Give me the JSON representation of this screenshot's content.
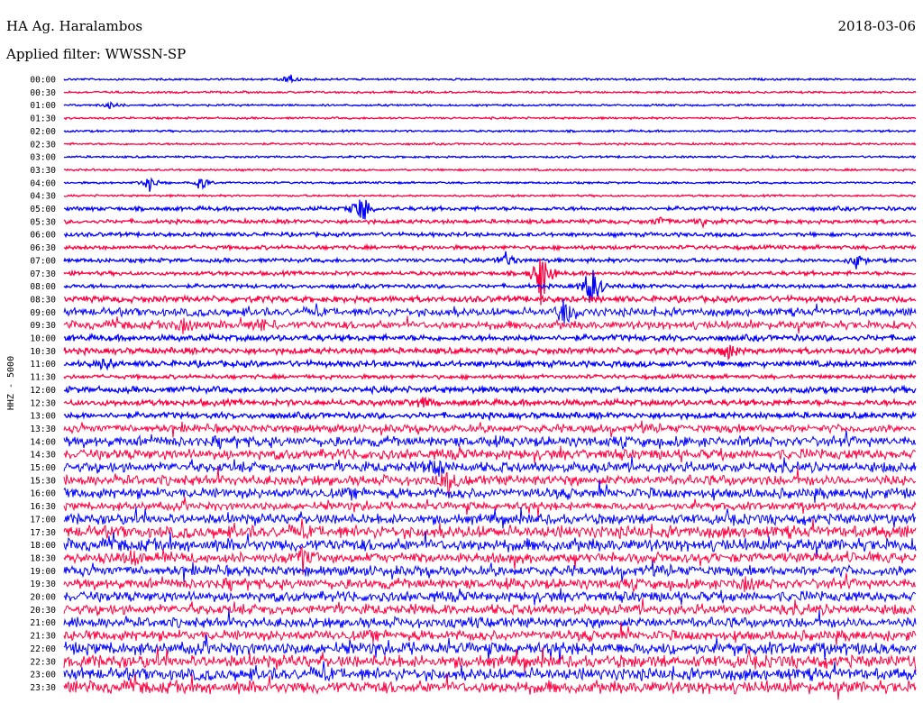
{
  "header": {
    "station": "HA Ag. Haralambos",
    "date": "2018-03-06",
    "filter": "Applied filter: WWSSN-SP"
  },
  "chart_data": {
    "type": "line",
    "ylabel": "HHZ - 5000",
    "row_labels": [
      "00:00",
      "00:30",
      "01:00",
      "01:30",
      "02:00",
      "02:30",
      "03:00",
      "03:30",
      "04:00",
      "04:30",
      "05:00",
      "05:30",
      "06:00",
      "06:30",
      "07:00",
      "07:30",
      "08:00",
      "08:30",
      "09:00",
      "09:30",
      "10:00",
      "10:30",
      "11:00",
      "11:30",
      "12:00",
      "12:30",
      "13:00",
      "13:30",
      "14:00",
      "14:30",
      "15:00",
      "15:30",
      "16:00",
      "16:30",
      "17:00",
      "17:30",
      "18:00",
      "18:30",
      "19:00",
      "19:30",
      "20:00",
      "20:30",
      "21:00",
      "21:30",
      "22:00",
      "22:30",
      "23:00",
      "23:30"
    ],
    "row_colors": [
      "#0000ff",
      "#ff0040"
    ],
    "noise_level": [
      1,
      1,
      1,
      1,
      1,
      1,
      1,
      1,
      1,
      1,
      2,
      2,
      2,
      2,
      2,
      2,
      2,
      3,
      4,
      4,
      3,
      3,
      3,
      2,
      3,
      3,
      3,
      4,
      5,
      5,
      5,
      5,
      5,
      4,
      5,
      6,
      6,
      5,
      5,
      5,
      5,
      5,
      5,
      5,
      6,
      6,
      6,
      6
    ],
    "events": [
      {
        "row": 0,
        "x": 0.265,
        "amp": 8
      },
      {
        "row": 2,
        "x": 0.055,
        "amp": 5
      },
      {
        "row": 8,
        "x": 0.1,
        "amp": 10
      },
      {
        "row": 8,
        "x": 0.16,
        "amp": 10
      },
      {
        "row": 10,
        "x": 0.35,
        "amp": 24
      },
      {
        "row": 11,
        "x": 0.7,
        "amp": 7
      },
      {
        "row": 11,
        "x": 0.75,
        "amp": 6
      },
      {
        "row": 14,
        "x": 0.52,
        "amp": 12
      },
      {
        "row": 14,
        "x": 0.93,
        "amp": 10
      },
      {
        "row": 15,
        "x": 0.56,
        "amp": 50
      },
      {
        "row": 16,
        "x": 0.62,
        "amp": 40
      },
      {
        "row": 18,
        "x": 0.59,
        "amp": 30
      },
      {
        "row": 19,
        "x": 0.14,
        "amp": 14
      },
      {
        "row": 19,
        "x": 0.23,
        "amp": 12
      },
      {
        "row": 21,
        "x": 0.78,
        "amp": 12
      },
      {
        "row": 22,
        "x": 0.05,
        "amp": 10
      },
      {
        "row": 25,
        "x": 0.42,
        "amp": 8
      },
      {
        "row": 30,
        "x": 0.44,
        "amp": 12
      },
      {
        "row": 31,
        "x": 0.45,
        "amp": 16
      },
      {
        "row": 37,
        "x": 0.08,
        "amp": 14
      },
      {
        "row": 37,
        "x": 0.28,
        "amp": 12
      },
      {
        "row": 39,
        "x": 0.8,
        "amp": 12
      }
    ]
  }
}
